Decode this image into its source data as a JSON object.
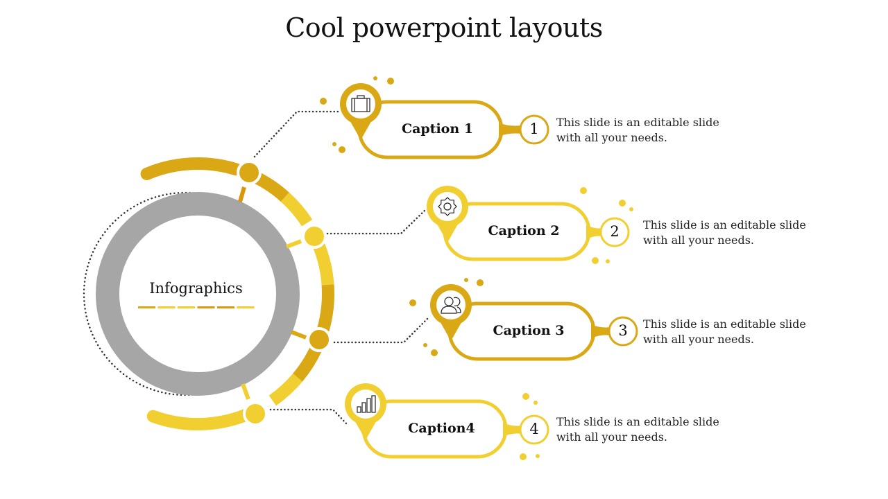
{
  "title": "Cool powerpoint layouts",
  "center": {
    "label": "Infographics",
    "dash_colors": [
      "#d9a814",
      "#f2cd2f",
      "#f2cd2f",
      "#d99a10",
      "#d99a10",
      "#f2cd2f"
    ]
  },
  "colors": {
    "dark_gold": "#d9a814",
    "light_gold": "#f2cf30",
    "orange_gold": "#dc9508",
    "ring_gray": "#a6a6a6",
    "dotted": "#333333"
  },
  "items": [
    {
      "caption": "Caption 1",
      "number": "1",
      "icon": "briefcase-icon",
      "description": [
        "This slide is an editable slide",
        "with all your needs."
      ],
      "color": "#d9a814"
    },
    {
      "caption": "Caption 2",
      "number": "2",
      "icon": "gear-icon",
      "description": [
        "This slide is an editable slide",
        "with all your needs."
      ],
      "color": "#f2cf30"
    },
    {
      "caption": "Caption 3",
      "number": "3",
      "icon": "users-icon",
      "description": [
        "This slide is an editable slide",
        "with all your needs."
      ],
      "color": "#d9a814"
    },
    {
      "caption": "Caption4",
      "number": "4",
      "icon": "bar-chart-icon",
      "description": [
        "This slide is an editable slide",
        "with all your needs."
      ],
      "color": "#f2cf30"
    }
  ]
}
